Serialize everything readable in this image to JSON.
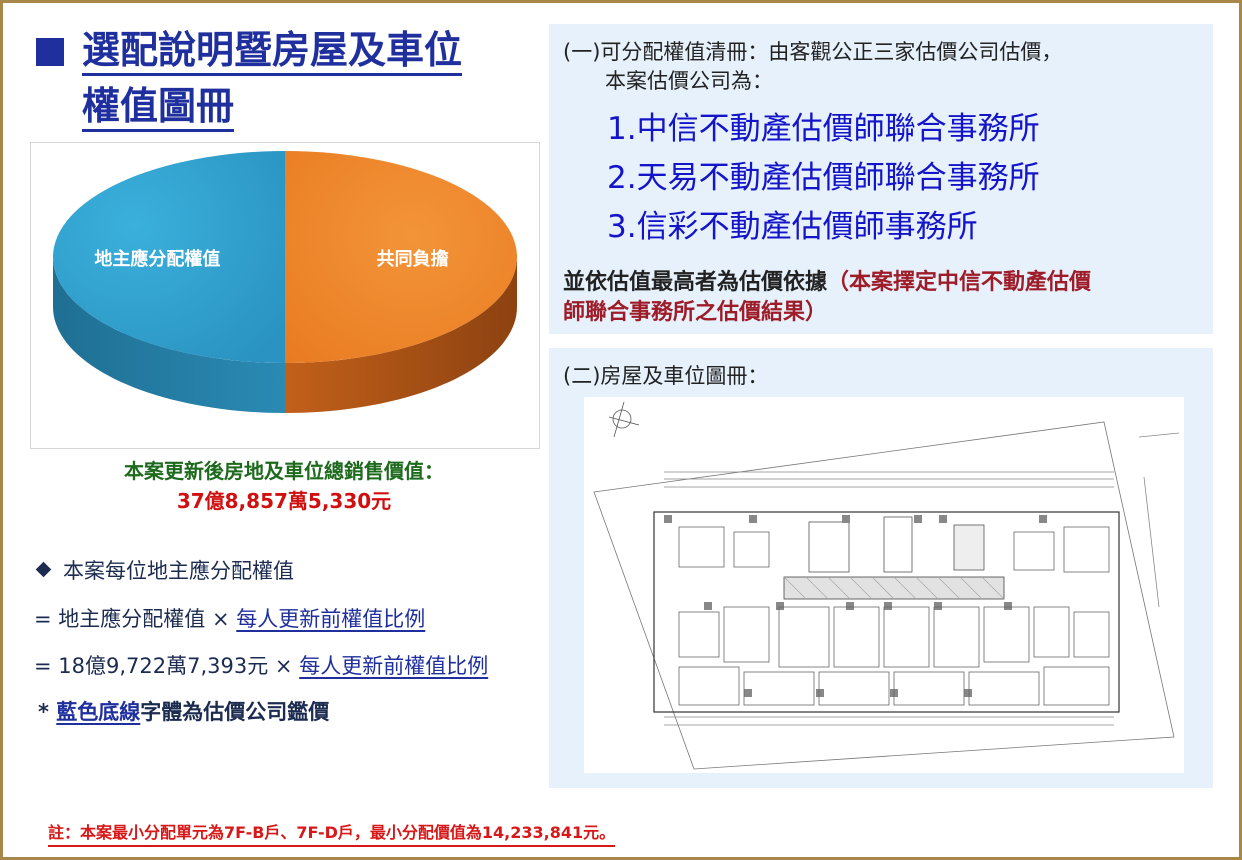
{
  "title": {
    "line1": "選配說明暨房屋及車位",
    "line2": "權值圖冊"
  },
  "chart_data": {
    "type": "pie",
    "categories": [
      "地主應分配權值",
      "共同負擔"
    ],
    "values": [
      50,
      50
    ],
    "colors": [
      "#2fa3d0",
      "#f08a2c"
    ],
    "label_color": "#ffffff"
  },
  "summary": {
    "label": "本案更新後房地及車位總銷售價值：",
    "value": "37億8,857萬5,330元"
  },
  "formula": {
    "heading": "本案每位地主應分配權值",
    "line1_prefix": "= 地主應分配權值 ×",
    "line1_link": "每人更新前權值比例",
    "line2_prefix": "=  18億9,722萬7,393元 ×",
    "line2_link": "每人更新前權值比例",
    "footnote_star": "*",
    "footnote_link": "藍色底線",
    "footnote_rest": "字體為估價公司鑑價"
  },
  "panel1": {
    "intro_line1": "(一)可分配權值清冊：由客觀公正三家估價公司估價，",
    "intro_line2": "本案估價公司為：",
    "firms": [
      "1.中信不動產估價師聯合事務所",
      "2.天易不動產估價師聯合事務所",
      "3.信彩不動產估價師事務所"
    ],
    "conclusion_black": "並依估值最高者為估價依據",
    "conclusion_red_1": "（本案擇定中信不動產估價",
    "conclusion_red_2": "師聯合事務所之估價結果）"
  },
  "panel2": {
    "heading": "(二)房屋及車位圖冊："
  },
  "note": "註：本案最小分配單元為7F-B戶、7F-D戶，最小分配價值為14,233,841元。"
}
